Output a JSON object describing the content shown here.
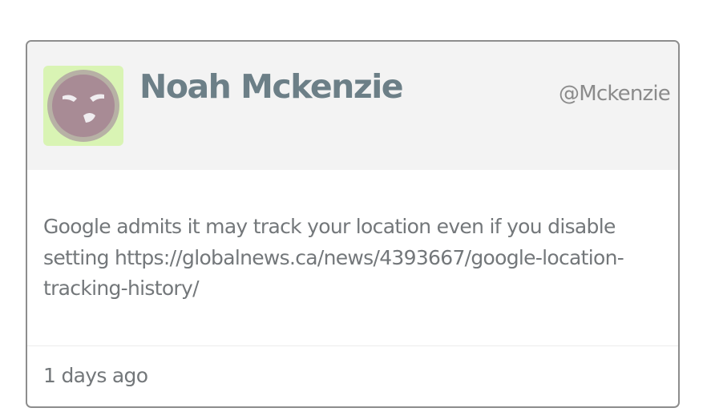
{
  "tweet": {
    "author_name": "Noah Mckenzie",
    "handle": "@Mckenzie",
    "text": "Google admits it may track your location even if you disable setting https://globalnews.ca/news/4393667/google-location-tracking-history/",
    "timestamp": "1 days ago",
    "avatar_icon": "angry-face-icon"
  },
  "colors": {
    "header_bg": "#f3f3f3",
    "name": "#6c7f87",
    "text": "#73777a",
    "avatar_bg": "#d9f4b4",
    "avatar_face": "#a88b95"
  }
}
